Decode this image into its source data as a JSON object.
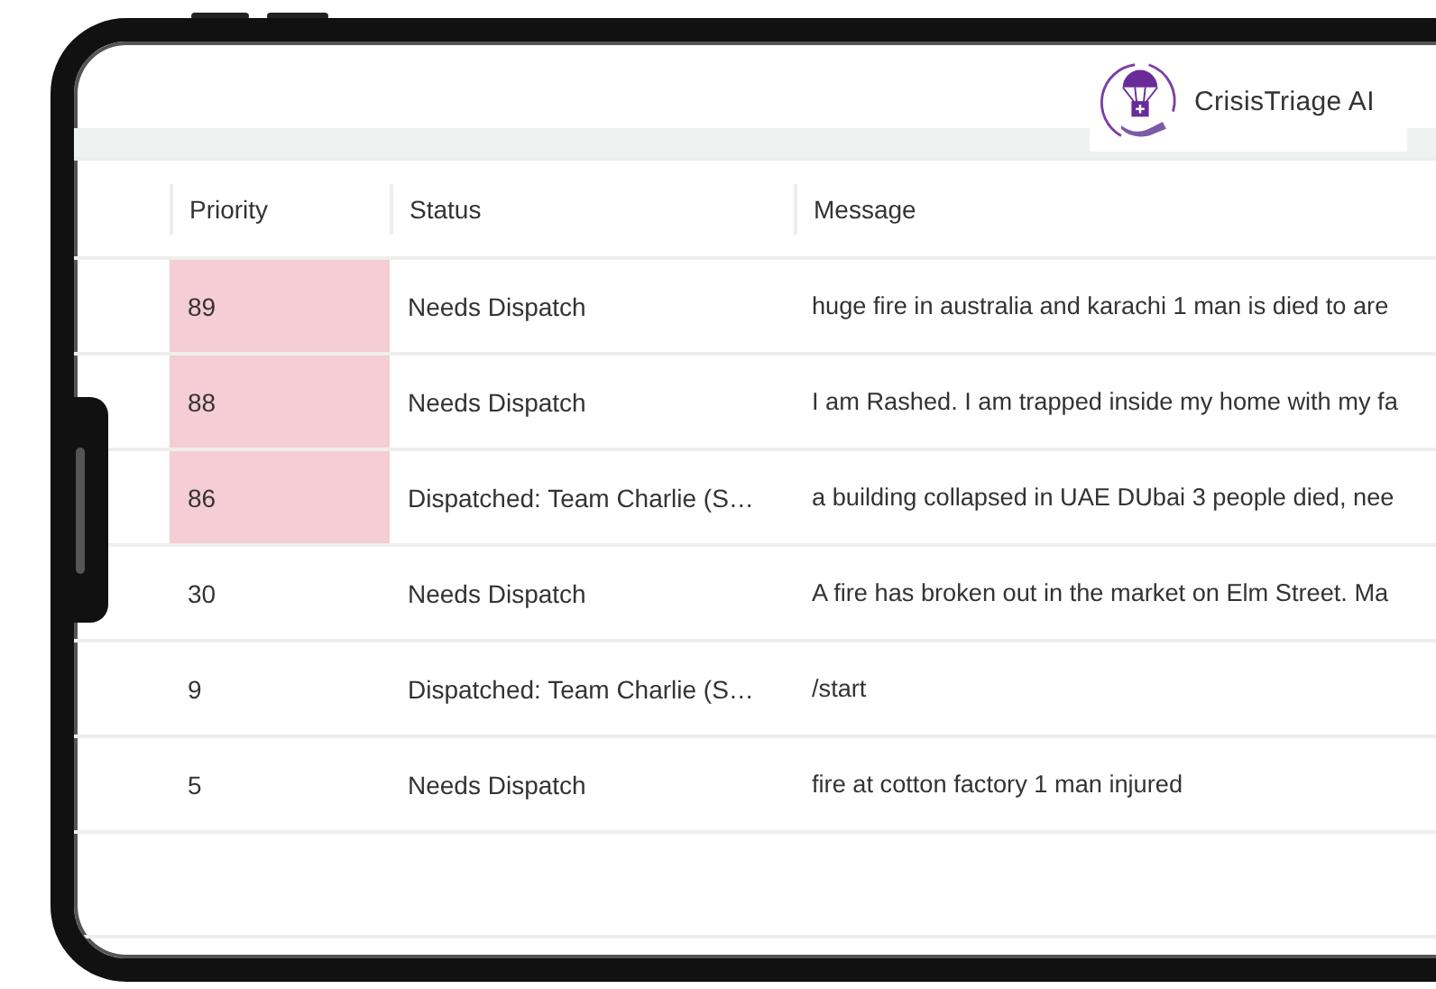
{
  "brand": {
    "name": "CrisisTriage AI"
  },
  "table": {
    "columns": [
      "Priority",
      "Status",
      "Message"
    ],
    "rows": [
      {
        "priority": "89",
        "status": "Needs Dispatch",
        "message": "huge fire in australia and karachi 1 man is died to are",
        "highlighted": true
      },
      {
        "priority": "88",
        "status": "Needs Dispatch",
        "message": "I am Rashed. I am trapped inside my home with my fa",
        "highlighted": true
      },
      {
        "priority": "86",
        "status": "Dispatched: Team Charlie (S…",
        "message": "a building collapsed in UAE DUbai 3 people died, nee",
        "highlighted": true
      },
      {
        "priority": "30",
        "status": "Needs Dispatch",
        "message": "A fire has broken out in the market on Elm Street. Ma",
        "highlighted": false
      },
      {
        "priority": "9",
        "status": "Dispatched: Team Charlie (S…",
        "message": "/start",
        "highlighted": false
      },
      {
        "priority": "5",
        "status": "Needs Dispatch",
        "message": "fire at cotton factory 1 man injured",
        "highlighted": false
      }
    ]
  }
}
